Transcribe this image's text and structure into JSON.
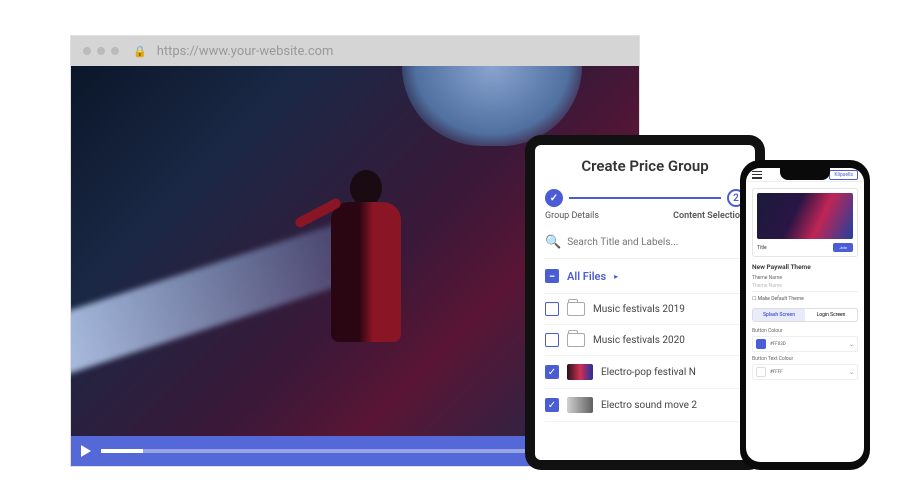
{
  "browser": {
    "url": "https://www.your-website.com"
  },
  "tablet": {
    "title": "Create Price Group",
    "steps": {
      "one": "Group Details",
      "two": "Content Selection",
      "check": "✓",
      "num": "2"
    },
    "search_placeholder": "Search Title and Labels...",
    "all_files": "All Files",
    "files": [
      {
        "label": "Music festivals 2019",
        "type": "folder",
        "checked": false
      },
      {
        "label": "Music festivals 2020",
        "type": "folder",
        "checked": false
      },
      {
        "label": "Electro-pop festival N",
        "type": "video",
        "checked": true
      },
      {
        "label": "Electro sound move 2",
        "type": "video",
        "checked": true
      }
    ]
  },
  "phone": {
    "brand": "Klipsells",
    "preview_title": "Title",
    "preview_btn": "Join",
    "section_title": "New Paywall Theme",
    "theme_name_label": "Theme Name",
    "theme_name_placeholder": "Theme Name",
    "make_default": "Make Default Theme",
    "tabs": {
      "splash": "Splash Screen",
      "login": "Login Screen"
    },
    "button_colour_label": "Button Colour",
    "button_colour_value": "#FF03D",
    "button_text_colour_label": "Button Text Colour",
    "button_text_colour_value": "#FFFF"
  }
}
